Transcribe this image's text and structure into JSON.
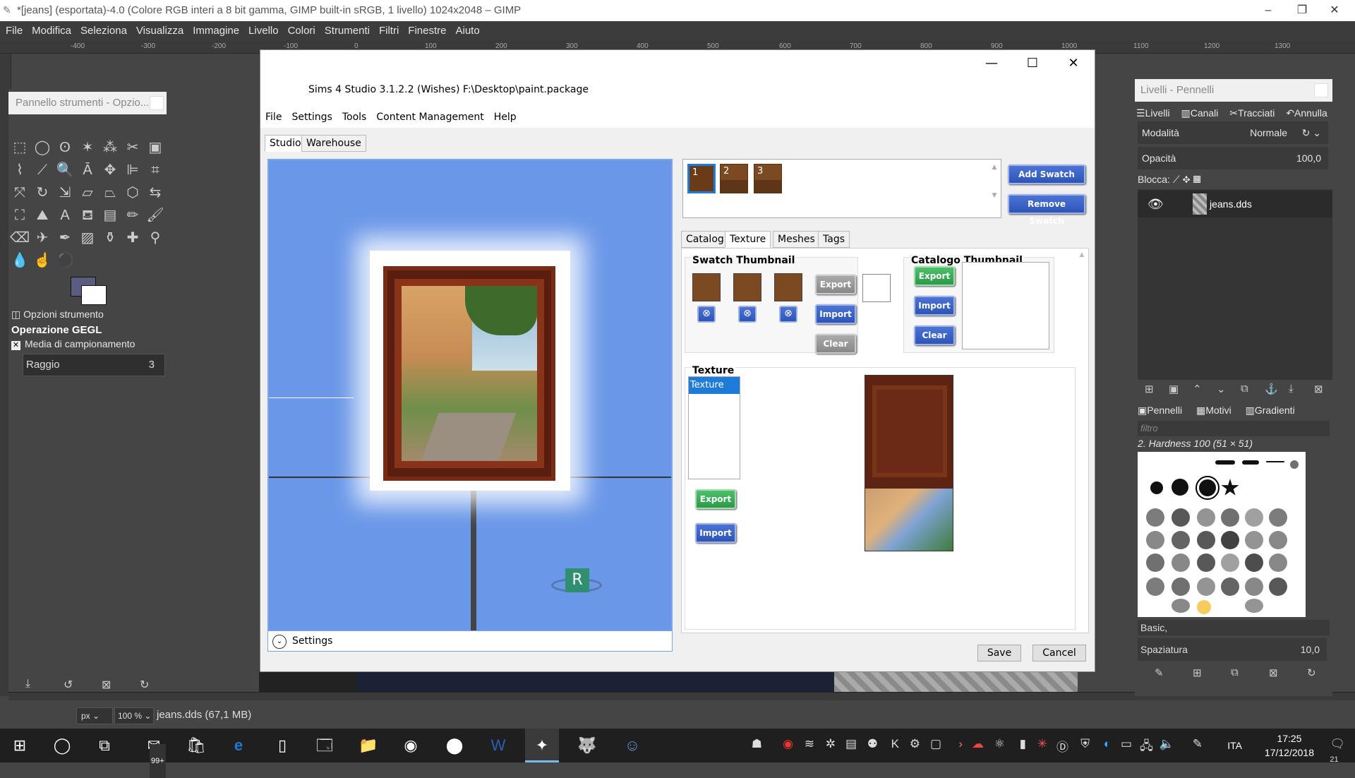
{
  "gimp": {
    "title": "*[jeans] (esportata)-4.0 (Colore RGB interi a 8 bit gamma, GIMP built-in sRGB, 1 livello) 1024x2048 – GIMP",
    "menu": [
      "File",
      "Modifica",
      "Seleziona",
      "Visualizza",
      "Immagine",
      "Livello",
      "Colori",
      "Strumenti",
      "Filtri",
      "Finestre",
      "Aiuto"
    ],
    "ruler_ticks": [
      "-400",
      "-300",
      "-200",
      "-100",
      "0",
      "100",
      "200",
      "300",
      "400",
      "500",
      "600",
      "700",
      "800",
      "900",
      "1000",
      "1100",
      "1200",
      "1300"
    ],
    "tool_panel_title": "Pannello strumenti - Opzio...",
    "tool_options_tab": "Opzioni strumento",
    "gegl_operation": "Operazione GEGL",
    "sampling_label": "Media di campionamento",
    "sampling_checked": true,
    "radius_label": "Raggio",
    "radius_value": "3",
    "unit": "px",
    "zoom": "100 %",
    "file_info": "jeans.dds (67,1 MB)",
    "fg_color": "#5a5d80",
    "bg_color": "#ffffff"
  },
  "layers_dock": {
    "title": "Livelli - Pennelli",
    "tabs": [
      "Livelli",
      "Canali",
      "Tracciati",
      "Annulla"
    ],
    "mode_label": "Modalità",
    "mode_value": "Normale",
    "opacity_label": "Opacità",
    "opacity_value": "100,0",
    "lock_label": "Blocca:",
    "layer_name": "jeans.dds",
    "brush_tabs": [
      "Pennelli",
      "Motivi",
      "Gradienti"
    ],
    "filter_placeholder": "filtro",
    "brush_name": "2. Hardness 100 (51 × 51)",
    "preset": "Basic,",
    "spacing_label": "Spaziatura",
    "spacing_value": "10,0"
  },
  "s4s": {
    "title": "Sims 4 Studio 3.1.2.2 (Wishes)  F:\\Desktop\\paint.package",
    "menu": [
      "File",
      "Settings",
      "Tools",
      "Content Management",
      "Help"
    ],
    "main_tabs": [
      "Studio",
      "Warehouse"
    ],
    "swatches": [
      "1",
      "2",
      "3"
    ],
    "add_swatch": "Add Swatch",
    "remove_swatch": "Remove Swatch",
    "panel_tabs": [
      "Catalog",
      "Texture",
      "Meshes",
      "Tags"
    ],
    "active_panel_tab": "Texture",
    "swatch_thumbnail_title": "Swatch Thumbnail",
    "catalog_thumbnail_title": "Catalogo Thumbnail",
    "export": "Export",
    "import": "Import",
    "clear": "Clear",
    "texture_title": "Texture",
    "texture_list": [
      "Texture"
    ],
    "viewport_settings": "Settings",
    "save": "Save",
    "cancel": "Cancel",
    "watermark": "R"
  },
  "taskbar": {
    "mail_badge": "99+",
    "language": "ITA",
    "time": "17:25",
    "date": "17/12/2018",
    "notifications": "21"
  }
}
